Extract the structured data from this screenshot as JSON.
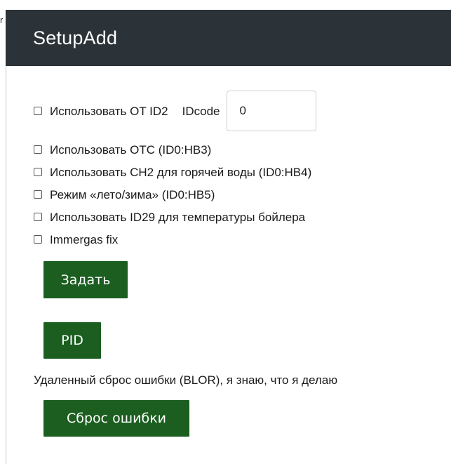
{
  "header": {
    "title": "SetupAdd"
  },
  "edge": {
    "glyph": "r"
  },
  "options": [
    {
      "label": "Использовать OT ID2",
      "checked": false
    },
    {
      "label": "Использовать OTC (ID0:HB3)",
      "checked": false
    },
    {
      "label": "Использовать CH2 для горячей воды (ID0:HB4)",
      "checked": false
    },
    {
      "label": "Режим «лето/зима» (ID0:HB5)",
      "checked": false
    },
    {
      "label": "Использовать ID29 для температуры бойлера",
      "checked": false
    },
    {
      "label": "Immergas fix",
      "checked": false
    }
  ],
  "idcode": {
    "label": "IDcode",
    "value": "0"
  },
  "buttons": {
    "set_label": "Задать",
    "pid_label": "PID",
    "reset_label": "Сброс ошибки"
  },
  "reset_note": "Удаленный сброс ошибки (BLOR), я знаю, что я делаю",
  "colors": {
    "header_bg": "#2b3238",
    "button_bg": "#1b5e20"
  }
}
